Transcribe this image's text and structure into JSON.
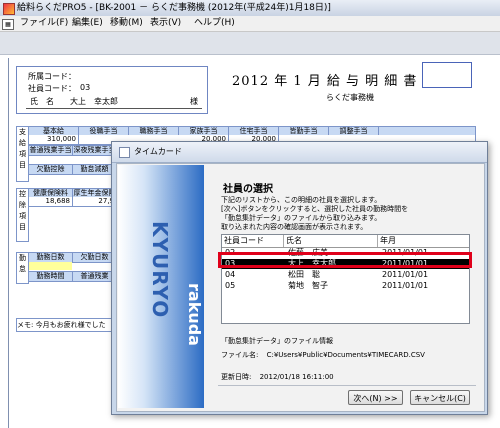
{
  "window": {
    "title": "給料らくだPRO5 - [BK-2001 － らくだ事務機 (2012年(平成24年)1月18日)]"
  },
  "menu": {
    "items": [
      "ファイル(F)",
      "編集(E)",
      "移動(M)",
      "表示(V)",
      "ヘルプ(H)"
    ]
  },
  "payslip": {
    "dept_code_label": "所属コード：",
    "emp_code_label": "社員コード：",
    "emp_code_value": "03",
    "name_label": "氏　名",
    "name_value": "大上　幸太郎",
    "honorific": "様",
    "title": "2012 年 1 月 給 与 明 細 書",
    "company": "らくだ事務機",
    "pay_section_label": "支給項目",
    "pay_headers": [
      "基本給",
      "役職手当",
      "職務手当",
      "家族手当",
      "住宅手当",
      "皆勤手当",
      "調整手当"
    ],
    "pay_values": [
      "310,000",
      "",
      "",
      "20,000",
      "20,000",
      "",
      ""
    ],
    "pay_headers2": [
      "普通残業手当",
      "深夜残業手当"
    ],
    "pay_headers3": [
      "欠勤控除",
      "勤怠減額"
    ],
    "deduction_section_label": "控除項目",
    "deduction_headers": [
      "健康保険料",
      "厚生年金保険"
    ],
    "deduction_values": [
      "18,688",
      "27,9"
    ],
    "attendance_section_label": "勤怠",
    "attendance_headers": [
      "勤務日数",
      "欠勤日数"
    ],
    "attendance_headers2": [
      "勤務時間",
      "普通残業"
    ],
    "memo": "メモ: 今月もお疲れ様でした"
  },
  "dialog": {
    "title": "タイムカード",
    "brand_main": "KYURYO",
    "brand_sub": "rakuda",
    "heading": "社員の選択",
    "description_lines": [
      "下記のリストから、この明細の社員を選択します。",
      "[次へ]ボタンをクリックすると、選択した社員の勤務時間を",
      "「勤怠集計データ」のファイルから取り込みます。",
      "取り込まれた内容の確認画面が表示されます。"
    ],
    "columns": [
      "社員コード",
      "氏名",
      "年月"
    ],
    "rows": [
      {
        "code": "02",
        "name": "佐藤　広美",
        "ym": "2011/01/01"
      },
      {
        "code": "03",
        "name": "大上　幸太郎",
        "ym": "2011/01/01"
      },
      {
        "code": "04",
        "name": "松田　聡",
        "ym": "2011/01/01"
      },
      {
        "code": "05",
        "name": "菊地　智子",
        "ym": "2011/01/01"
      }
    ],
    "selected_index": 1,
    "file_info_heading": "「勤怠集計データ」のファイル情報",
    "file_name_label": "ファイル名:",
    "file_name_value": "C:¥Users¥Public¥Documents¥TIMECARD.CSV",
    "updated_label": "更新日時:",
    "updated_value": "2012/01/18 16:11:00",
    "next_button": "次へ(N) >>",
    "cancel_button": "キャンセル(C)"
  }
}
